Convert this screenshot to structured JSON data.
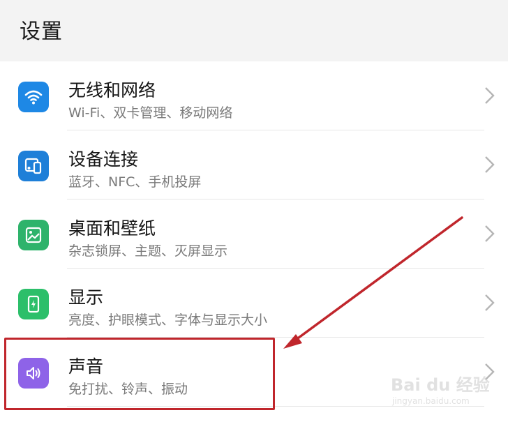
{
  "header": {
    "title": "设置"
  },
  "items": [
    {
      "title": "无线和网络",
      "subtitle": "Wi-Fi、双卡管理、移动网络",
      "icon": "wifi-icon",
      "color": "#1E88E5"
    },
    {
      "title": "设备连接",
      "subtitle": "蓝牙、NFC、手机投屏",
      "icon": "device-connection-icon",
      "color": "#1E7FD8"
    },
    {
      "title": "桌面和壁纸",
      "subtitle": "杂志锁屏、主题、灭屏显示",
      "icon": "wallpaper-icon",
      "color": "#2EB36B"
    },
    {
      "title": "显示",
      "subtitle": "亮度、护眼模式、字体与显示大小",
      "icon": "display-brightness-icon",
      "color": "#2CBF6A"
    },
    {
      "title": "声音",
      "subtitle": "免打扰、铃声、振动",
      "icon": "sound-speaker-icon",
      "color": "#8E63E8"
    }
  ],
  "annotation": {
    "color": "#C0262C"
  },
  "watermark": {
    "brand": "Bai du 经验",
    "url": "jingyan.baidu.com"
  }
}
